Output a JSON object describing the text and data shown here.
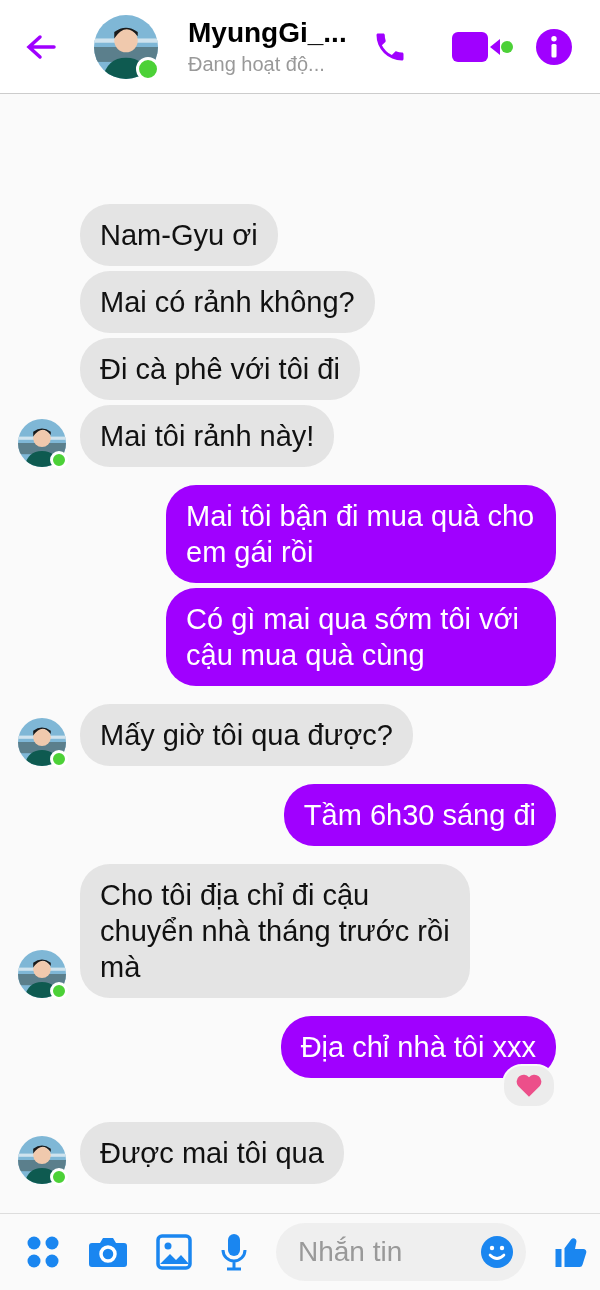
{
  "header": {
    "name": "MyungGi_...",
    "status": "Đang hoạt độ...",
    "online": true
  },
  "groups": [
    {
      "kind": "them",
      "messages": [
        {
          "text": "Nam-Gyu ơi",
          "reacted": false
        },
        {
          "text": "Mai có rảnh không?",
          "reacted": false
        },
        {
          "text": "Đi cà phê với tôi đi",
          "reacted": false
        },
        {
          "text": "Mai tôi rảnh này!",
          "reacted": false
        }
      ]
    },
    {
      "kind": "me",
      "messages": [
        {
          "text": "Mai tôi bận đi mua quà cho em gái rồi",
          "reacted": false
        },
        {
          "text": "Có gì mai qua sớm tôi với cậu mua quà cùng",
          "reacted": false
        }
      ]
    },
    {
      "kind": "them",
      "messages": [
        {
          "text": "Mấy giờ tôi qua được?",
          "reacted": false
        }
      ]
    },
    {
      "kind": "me",
      "messages": [
        {
          "text": "Tầm 6h30 sáng đi",
          "reacted": false
        }
      ]
    },
    {
      "kind": "them",
      "messages": [
        {
          "text": "Cho tôi địa chỉ đi cậu chuyển nhà tháng trước rồi mà",
          "reacted": false
        }
      ]
    },
    {
      "kind": "me",
      "messages": [
        {
          "text": "Địa chỉ nhà tôi xxx",
          "reacted": true
        }
      ]
    },
    {
      "kind": "them",
      "messages": [
        {
          "text": "Được mai tôi qua",
          "reacted": false
        }
      ]
    }
  ],
  "composer": {
    "placeholder": "Nhắn tin"
  }
}
